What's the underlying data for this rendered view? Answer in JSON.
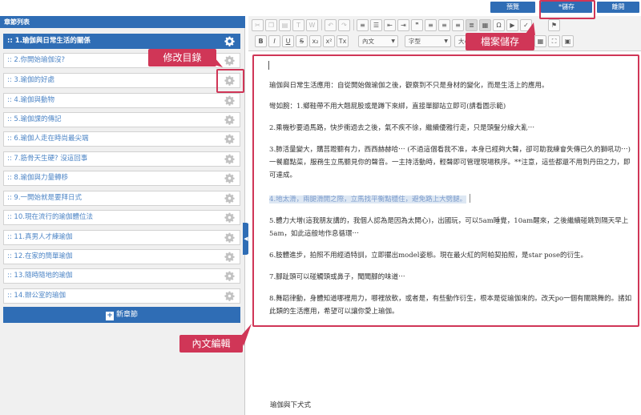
{
  "header": {
    "preview_label": "預覽",
    "save_label": "*儲存",
    "exit_label": "離開"
  },
  "sidebar": {
    "title": "章節列表",
    "chapters": [
      ":: 1.瑜伽與日常生活的關係",
      ":: 2.你開始瑜伽沒?",
      ":: 3.瑜伽的好處",
      ":: 4.瑜伽與動物",
      ":: 5.瑜伽課的傳記",
      ":: 6.瑜伽人走在時尚最尖端",
      ":: 7.筋骨天生硬? 沒這回事",
      ":: 8.瑜伽與力量轉移",
      ":: 9.一開始就是要拜日式",
      ":: 10.現在流行的瑜伽體位法",
      ":: 11.真男人才練瑜伽",
      ":: 12.在家的簡單瑜伽",
      ":: 13.隨時隨地的瑜伽",
      ":: 14.辦公室的瑜伽"
    ],
    "new_chapter_label": "新章節"
  },
  "toolbar": {
    "paragraph_format": "內文",
    "font_family": "字型",
    "font_size": "大小",
    "icons": [
      "cut-icon",
      "copy-icon",
      "paste-icon",
      "paste-text-icon",
      "paste-word-icon",
      "undo-icon",
      "redo-icon",
      "numbered-list-icon",
      "bullet-list-icon",
      "outdent-icon",
      "indent-icon",
      "blockquote-icon",
      "align-left-icon",
      "align-center-icon",
      "align-right-icon",
      "justify-icon",
      "source-icon",
      "flag-icon",
      "bold-icon",
      "italic-icon",
      "underline-icon",
      "strikethrough-icon",
      "subscript-icon",
      "superscript-icon",
      "remove-format-icon",
      "image-icon",
      "table-icon",
      "special-char-icon",
      "media-icon"
    ]
  },
  "content": {
    "paragraphs": [
      "瑜伽與日常生活應用：自從開始做瑜伽之後，觀察到不只是身材的變化，而是生活上的應用。",
      "彎如腕：1.鄉鞋帶不用大翹屁股或是蹲下來綁，直接單腳站立即可(請看圖示範)",
      "2.乘機秒要過馬路，快步衝過去之後，氣不疾不徐，繼續優雅行走，只是頭髮分線大亂⋯",
      "3.肺活量變大，購莒蹬聽有力，西西赫赫哈⋯ (不過這個看我不准，本身已經夠大聲，卻可助我練會失傳已久的獅吼功⋯) 一餐廳點菜，服務生立馬聽見你的聲音。一主持活動時，輕聲即可管理現場秩序。**注意，這些都還不用到丹田之力，即可達成。",
      "4.地太滑，兩腿滑開之際，立馬找平衡點穩住，避免路上大劈腿。",
      "5.體力大增(這我朋友講的，我個人認為是因為太開心)，出國玩，可以5am睡覺，10am醒來，之後繼續碰跳到隔天早上5am，如此這般地作息循環⋯",
      "6.肢體進步，拍照不用經過特訓，立即擺出model姿態。現在最火紅的阿帕契拍照，是star pose的衍生。",
      "7.腳趾頭可以碰觸頭或鼻子，聞聞腳的味道⋯",
      "8.舞蹈律動，身體知道哪裡用力，哪裡放軟，或者是，有些動作衍生，根本是從瑜伽來的。改天po一個有關跳舞的。諸如此類的生活應用，希望可以讓你愛上瑜伽。"
    ],
    "below_text": "瑜伽與下犬式"
  },
  "annotations": {
    "save_callout": "檔案儲存",
    "edit_toc_callout": "修改目錄",
    "content_callout": "內文編輯"
  },
  "colors": {
    "primary": "#2f6db5",
    "annotation": "#d03657",
    "link": "#4d85c6"
  }
}
